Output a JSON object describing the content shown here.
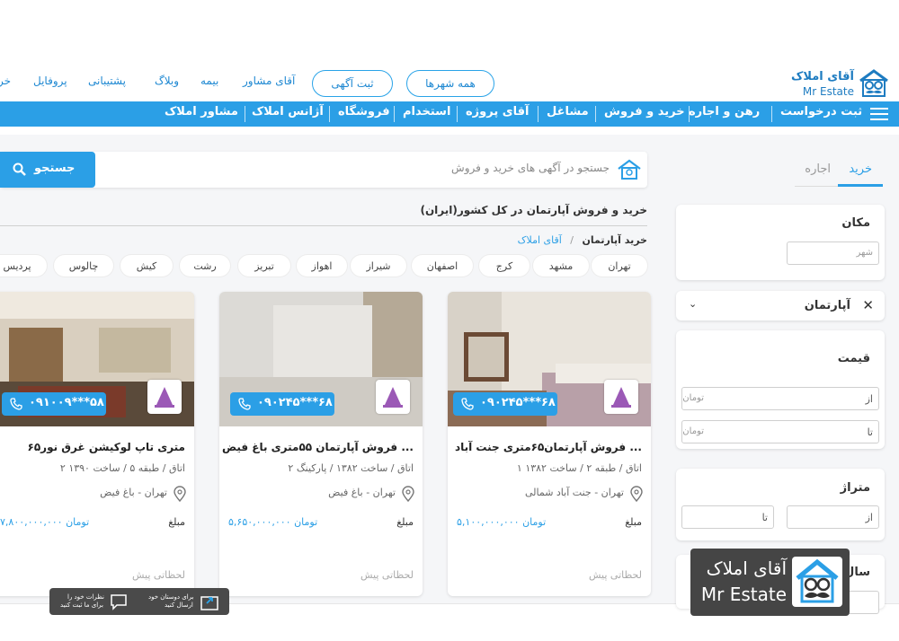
{
  "header": {
    "logo_fa": "آقای املاک",
    "logo_en": "Mr Estate",
    "links": [
      "آقای مشاور",
      "بیمه",
      "وبلاگ",
      "پشتیبانی",
      "پروفایل",
      "خر"
    ],
    "all_cities_button": "همه شهرها",
    "post_ad_button": "ثبت آگهی"
  },
  "navbar": {
    "items": [
      "ثبت درخواست",
      "رهن و اجاره",
      "خرید و فروش",
      "مشاغل",
      "آقای پروژه",
      "استخدام",
      "فروشگاه",
      "آژانس املاک",
      "مشاور املاک"
    ]
  },
  "sidebar": {
    "tab_buy": "خرید",
    "tab_rent": "اجاره",
    "location_title": "مکان",
    "city_placeholder": "شهر",
    "type_selected": "آپارتمان",
    "price_title": "قیمت",
    "from_label": "از",
    "to_label": "تا",
    "toman_placeholder": "تومان",
    "area_title": "متراژ",
    "year_title_partial": "سال"
  },
  "search": {
    "placeholder": "جستجو در آگهی های خرید و فروش",
    "button": "جستجو"
  },
  "page": {
    "title": "خرید و فروش آپارتمان در کل کشور(ایران)",
    "breadcrumb_home": "آقای املاک",
    "breadcrumb_sep": "/",
    "breadcrumb_current": "خرید آپارتمان"
  },
  "cities": [
    "تهران",
    "مشهد",
    "کرج",
    "اصفهان",
    "شیراز",
    "اهواز",
    "تبریز",
    "رشت",
    "کیش",
    "چالوس",
    "پردیس"
  ],
  "listings": [
    {
      "title": "فروش آپارتمان۶۵متری جنت آباد ...",
      "specs": "۱ اتاق / طبقه ۲ / ساخت ۱۳۸۲",
      "location": "تهران - جنت آباد شمالی",
      "price_label": "مبلغ",
      "price": "۵,۱۰۰,۰۰۰,۰۰۰ تومان",
      "phone": "۰۹۰۲۴۵***۶۸",
      "time": "لحظاتی پیش"
    },
    {
      "title": "فروش آپارتمان ۵۵متری باغ فیض ...",
      "specs": "۲ اتاق / ساخت ۱۳۸۲ / پارکینگ",
      "location": "تهران - باغ فیض",
      "price_label": "مبلغ",
      "price": "۵,۶۵۰,۰۰۰,۰۰۰ تومان",
      "phone": "۰۹۰۲۴۵***۶۸",
      "time": "لحظاتی پیش"
    },
    {
      "title": "۶۵متری تاپ لوکیشن غرق نور",
      "specs": "۲ اتاق / طبقه ۵ / ساخت ۱۳۹۰",
      "location": "تهران - باغ فیض",
      "price_label": "مبلغ",
      "price": "۷,۸۰۰,۰۰۰,۰۰۰ تومان",
      "phone": "۰۹۱۰۰۹***۵۸",
      "time": "لحظاتی پیش"
    }
  ],
  "float_bar": {
    "feedback_line1": "نظرات خود را",
    "feedback_line2": "برای ما ثبت کنید",
    "share_line1": "برای دوستان خود",
    "share_line2": "ارسال کنید"
  },
  "colors": {
    "accent": "#2b9fe6",
    "brand": "#1e7cc1"
  }
}
